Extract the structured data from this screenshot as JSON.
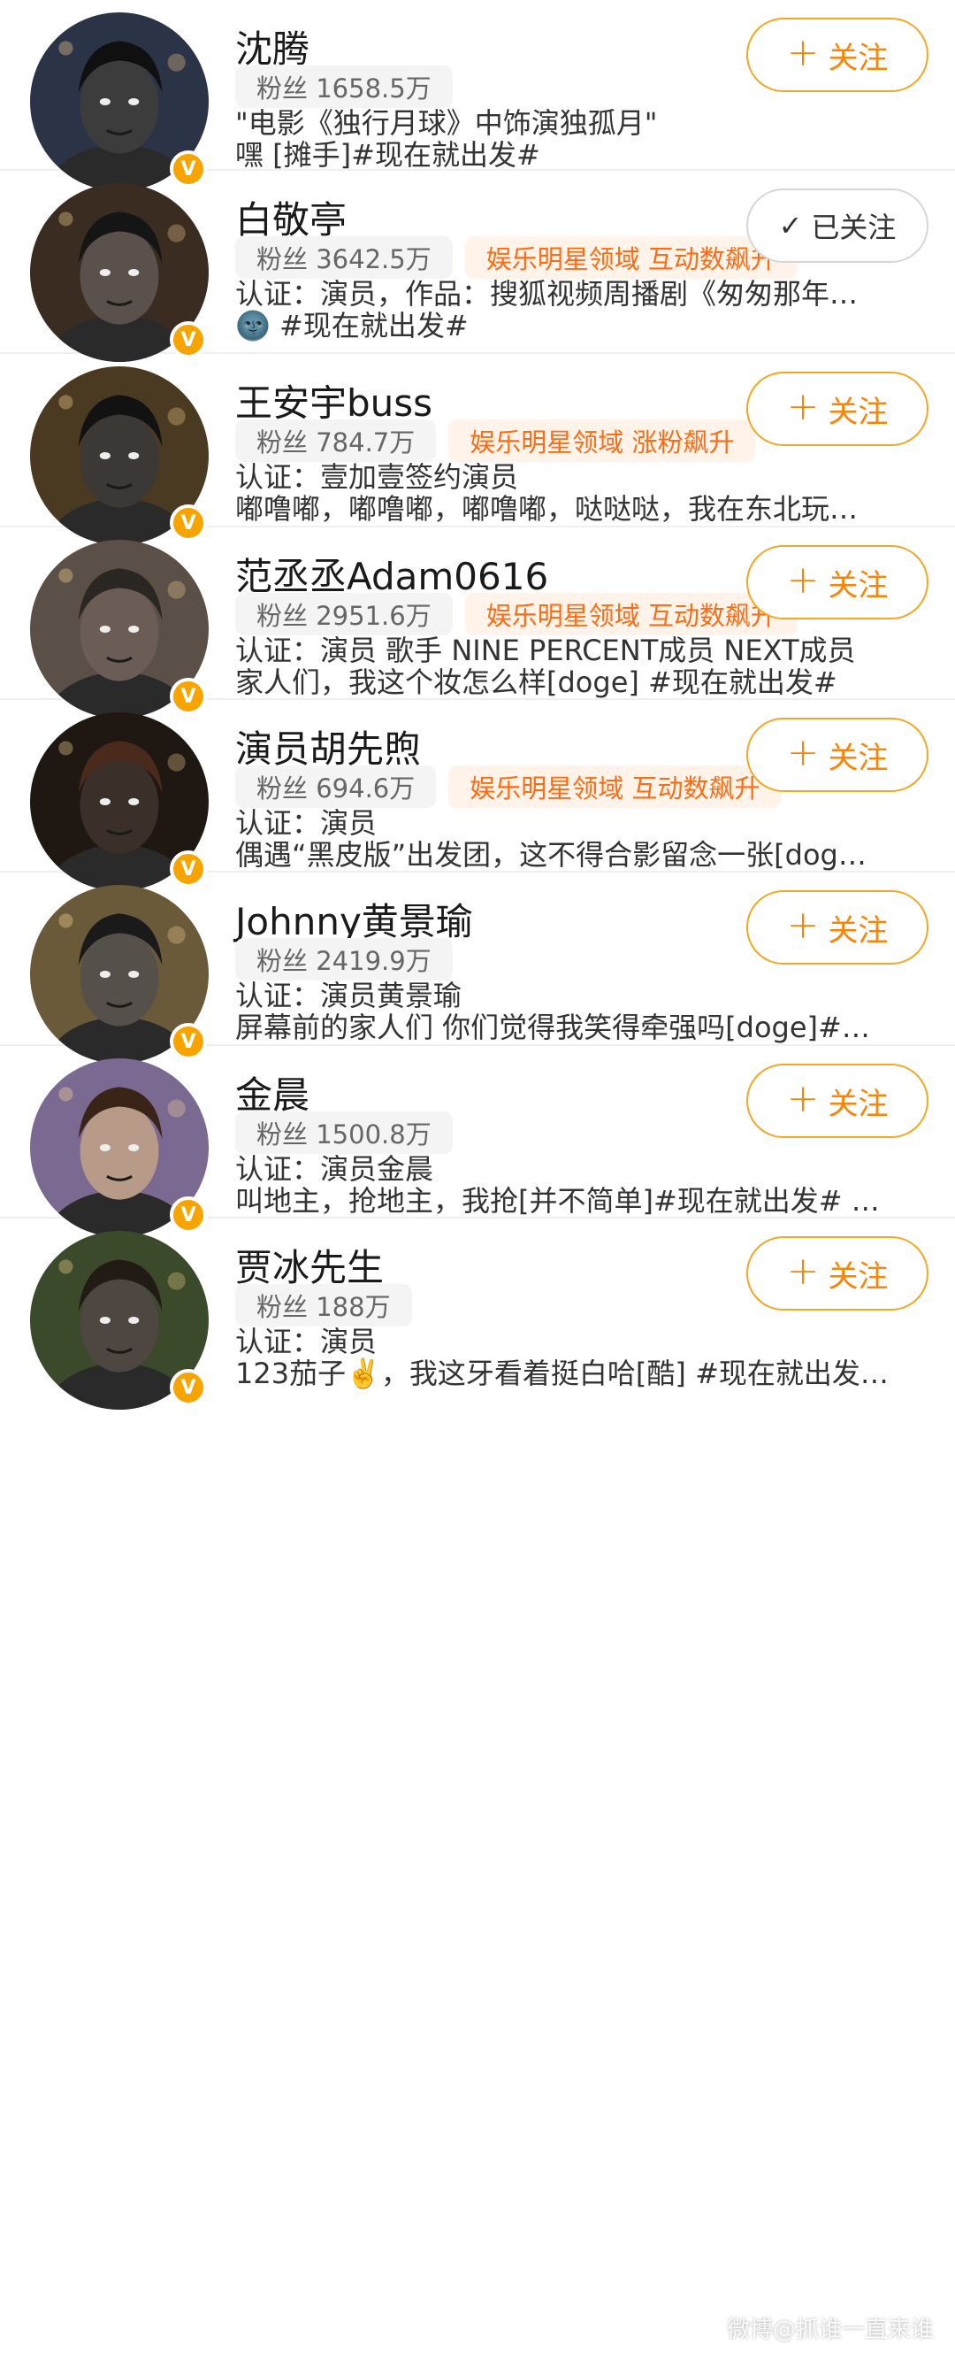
{
  "users": [
    {
      "name": "沈腾",
      "fans": "粉丝 1658.5万",
      "hot": "",
      "line1": "\"电影《独行月球》中饰演独孤月\"",
      "line2": "嘿 [摊手]#现在就出发#",
      "button": "关注",
      "followed": false,
      "bg": "#2b3346",
      "skin": "#3c3c3c",
      "hair": "#101010"
    },
    {
      "name": "白敬亭",
      "fans": "粉丝 3642.5万",
      "hot": "娱乐明星领域 互动数飙升",
      "line1": "认证：演员，作品：搜狐视频周播剧《匆匆那年…",
      "line2": "#现在就出发#",
      "button": "已关注",
      "followed": true,
      "bg": "#3a2c20",
      "skin": "#5a514c",
      "hair": "#151515"
    },
    {
      "name": "王安宇buss",
      "fans": "粉丝 784.7万",
      "hot": "娱乐明星领域 涨粉飙升",
      "line1": "认证：壹加壹签约演员",
      "line2": "嘟噜嘟，嘟噜嘟，嘟噜嘟，哒哒哒，我在东北玩…",
      "button": "关注",
      "followed": false,
      "bg": "#4a3a22",
      "skin": "#3b3836",
      "hair": "#121212"
    },
    {
      "name": "范丞丞Adam0616",
      "fans": "粉丝 2951.6万",
      "hot": "娱乐明星领域 互动数飙升",
      "line1": "认证：演员 歌手 NINE PERCENT成员 NEXT成员",
      "line2": "家人们，我这个妆怎么样[doge] #现在就出发#",
      "button": "关注",
      "followed": false,
      "bg": "#5a5048",
      "skin": "#6b5d55",
      "hair": "#2a2622"
    },
    {
      "name": "演员胡先煦",
      "fans": "粉丝 694.6万",
      "hot": "娱乐明星领域 互动数飙升",
      "line1": "认证：演员",
      "line2": "偶遇“黑皮版”出发团，这不得合影留念一张[dog…",
      "button": "关注",
      "followed": false,
      "bg": "#1e1712",
      "skin": "#3a2f29",
      "hair": "#4a2a1a"
    },
    {
      "name": "Johnny黄景瑜",
      "fans": "粉丝 2419.9万",
      "hot": "",
      "line1": "认证：演员黄景瑜",
      "line2": "屏幕前的家人们 你们觉得我笑得牵强吗[doge]#…",
      "button": "关注",
      "followed": false,
      "bg": "#6a5a3a",
      "skin": "#56504a",
      "hair": "#1a1a1a"
    },
    {
      "name": "金晨",
      "fans": "粉丝 1500.8万",
      "hot": "",
      "line1": "认证：演员金晨",
      "line2": "叫地主，抢地主，我抢[并不简单]#现在就出发# …",
      "button": "关注",
      "followed": false,
      "bg": "#7a6a92",
      "skin": "#b89a88",
      "hair": "#3a2418"
    },
    {
      "name": "贾冰先生",
      "fans": "粉丝 188万",
      "hot": "",
      "line1": "认证：演员",
      "line2": "123茄子✌️，我这牙看着挺白哈[酷] #现在就出发…",
      "button": "关注",
      "followed": false,
      "bg": "#3a4a2a",
      "skin": "#4e4640",
      "hair": "#221a14"
    }
  ],
  "watermark": "微博@抓谁一直来谁"
}
